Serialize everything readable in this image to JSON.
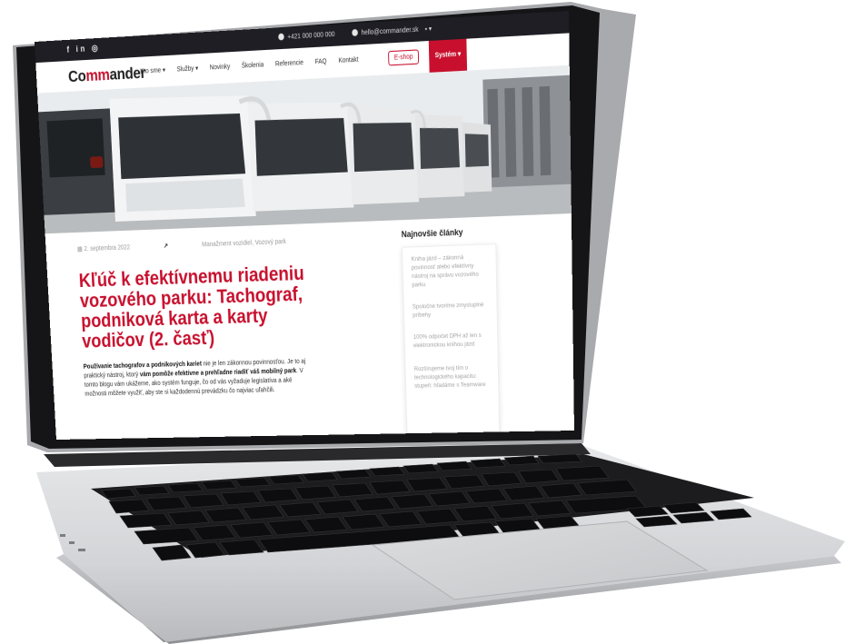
{
  "topbar": {
    "social": "f in ◎",
    "phone": "+421 000 000 000",
    "email": "hello@commander.sk"
  },
  "nav": {
    "logo_prefix": "Co",
    "logo_mid": "mm",
    "logo_suffix": "ander",
    "items": [
      "Kto sme ▾",
      "Služby ▾",
      "Novinky",
      "Školenia",
      "Referencie",
      "FAQ",
      "Kontakt"
    ],
    "cta": "E-shop",
    "system": "Systém ▾"
  },
  "article": {
    "date": "2. septembra 2022",
    "category": "Manažment vozidiel, Vozový park",
    "title": "Kľúč k efektívnemu riadeniu vozového parku: Tachograf, podniková karta a karty vodičov (2. časť)",
    "lead_bold": "Používanie tachografov a podnikových kariet",
    "lead_text": " nie je len zákonnou povinnosťou. Je to aj praktický nástroj, ktorý ",
    "lead_bold2": "vám pomôže efektívne a prehľadne riadiť váš mobilný park",
    "lead_text2": ". V tomto blogu vám ukážeme, ako systém funguje, čo od vás vyžaduje legislatíva a aké možnosti môžete využiť, aby ste si každodennú prevádzku čo najviac uľahčili."
  },
  "sidebar": {
    "title": "Najnovšie články",
    "items": [
      "Kniha jázd – zákonná povinnosť alebo efektívny nástroj na správu vozového parku",
      "Spoločne tvoríme zmysluplné príbehy",
      "100% odpočet DPH až len s elektronickou knihou jázd",
      "Rozšírujeme tvoj tím o technologického kapacitu: stupeň: hľadáme s Teamware"
    ]
  },
  "colors": {
    "accent": "#c8102e",
    "topbar": "#1e1e24",
    "bezel": "#1a1a1c",
    "chassis": "#cfd0d2"
  }
}
